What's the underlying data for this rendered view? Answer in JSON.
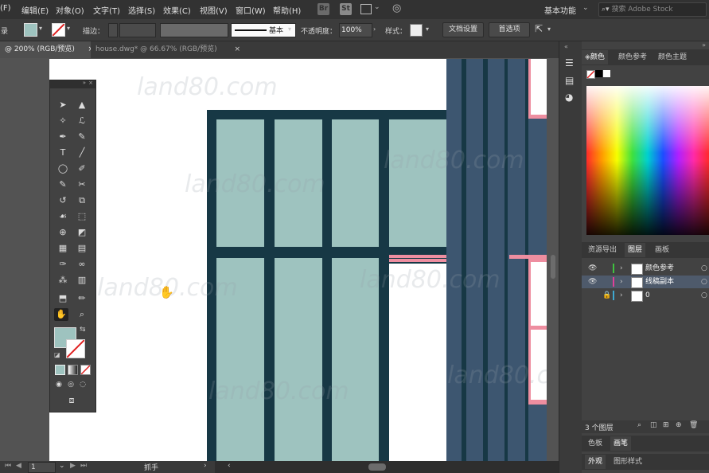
{
  "menu": {
    "items": [
      "(F)",
      "编辑(E)",
      "对象(O)",
      "文字(T)",
      "选择(S)",
      "效果(C)",
      "视图(V)",
      "窗口(W)",
      "帮助(H)"
    ],
    "br_icon": "Br",
    "st_icon": "St",
    "workspace": "基本功能",
    "search_placeholder": "搜索 Adobe Stock"
  },
  "control": {
    "left_label": "录",
    "stroke_label": "描边：",
    "stroke_profile": "基本",
    "opacity_label": "不透明度：",
    "opacity_value": "100%",
    "style_label": "样式：",
    "doc_setup": "文档设置",
    "preferences": "首选项"
  },
  "tabs": {
    "active": "@ 200% (RGB/预览)",
    "second": "house.dwg* @ 66.67% (RGB/预览)",
    "close": "×"
  },
  "watermark": "land80.com",
  "panel": {
    "color_tabs": [
      "颜色",
      "颜色参考",
      "颜色主题"
    ],
    "layer_tabs": [
      "资源导出",
      "图层",
      "画板"
    ],
    "layers": [
      {
        "name": "颜色参考"
      },
      {
        "name": "线稿副本"
      },
      {
        "name": "0"
      }
    ],
    "layer_count": "3 个图层",
    "bottom_tabs1": [
      "色板",
      "画笔"
    ],
    "bottom_tabs2": [
      "外观",
      "图形样式"
    ]
  },
  "status": {
    "page": "1",
    "tool_name": "抓手"
  },
  "colors": {
    "frame": "#173845",
    "glass": "#9ec3bf",
    "blue_panel": "#3d5670",
    "pink": "#ee8ea0",
    "fill_swatch": "#9ec3bf"
  }
}
